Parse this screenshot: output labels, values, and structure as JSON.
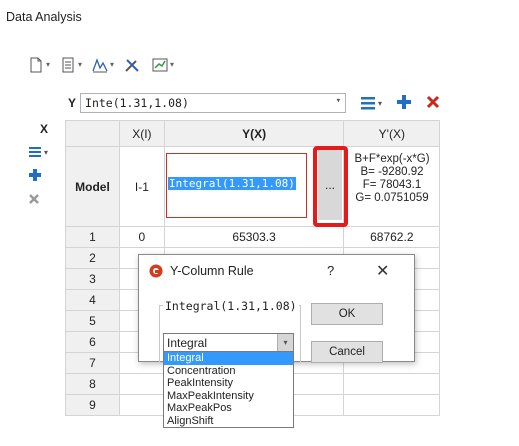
{
  "app": {
    "title": "Data Analysis"
  },
  "toolbar": {
    "icons": [
      "new-document-icon",
      "document-list-icon",
      "peak-tool-icon",
      "tools-icon",
      "chart-icon"
    ]
  },
  "ycolumn": {
    "label": "Y",
    "value": "Inte(1.31,1.08)"
  },
  "left_panel": {
    "x_label": "X"
  },
  "table": {
    "headers": [
      "",
      "X(I)",
      "Y(X)",
      "Y'(X)"
    ],
    "model_row": {
      "label": "Model",
      "x": "I-1",
      "y": "Integral(1.31,1.08)",
      "ellipsis": "...",
      "formula": [
        "B+F*exp(-x*G)",
        "B= -9280.92",
        "F= 78043.1",
        "G= 0.0751059"
      ]
    },
    "rows": [
      {
        "n": "1",
        "x": "0",
        "y": "65303.3",
        "yp": "68762.2"
      },
      {
        "n": "2",
        "x": "",
        "y": "",
        "yp": ""
      },
      {
        "n": "3",
        "x": "",
        "y": "",
        "yp": ""
      },
      {
        "n": "4",
        "x": "",
        "y": "",
        "yp": ""
      },
      {
        "n": "5",
        "x": "",
        "y": "",
        "yp": ""
      },
      {
        "n": "6",
        "x": "",
        "y": "",
        "yp": ""
      },
      {
        "n": "7",
        "x": "",
        "y": "",
        "yp": ""
      },
      {
        "n": "8",
        "x": "",
        "y": "",
        "yp": ""
      },
      {
        "n": "9",
        "x": "",
        "y": "",
        "yp": ""
      }
    ]
  },
  "dialog": {
    "title": "Y-Column Rule",
    "help": "?",
    "close": "✕",
    "group_label": "Integral(1.31,1.08)",
    "combo_value": "Integral",
    "ok_label": "OK",
    "cancel_label": "Cancel",
    "options": [
      "Integral",
      "Concentration",
      "PeakIntensity",
      "MaxPeakIntensity",
      "MaxPeakPos",
      "AlignShift"
    ],
    "selected_option": "Integral"
  },
  "colors": {
    "highlight": "#e51b1b",
    "selection": "#3399ff",
    "accent_blue": "#1f6fc5",
    "delete_red": "#c8281e"
  }
}
